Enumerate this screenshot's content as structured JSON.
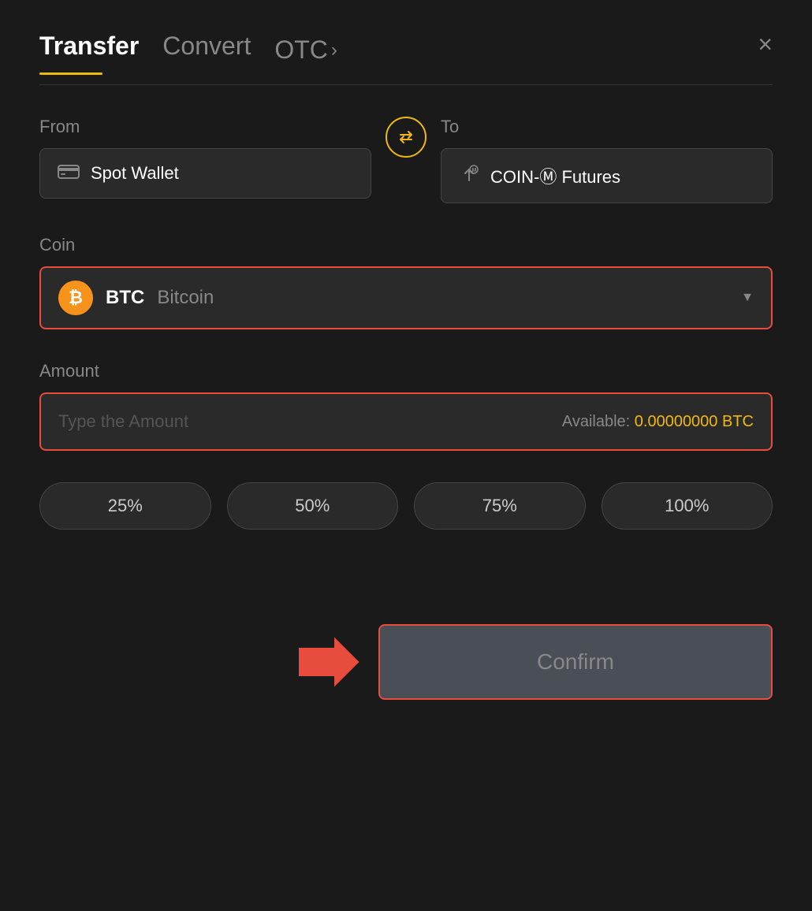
{
  "header": {
    "tab_transfer": "Transfer",
    "tab_convert": "Convert",
    "tab_otc": "OTC",
    "tab_otc_chevron": "›",
    "close_label": "×"
  },
  "from": {
    "label": "From",
    "wallet_icon": "▬",
    "wallet_name": "Spot Wallet"
  },
  "swap": {
    "icon": "⇄"
  },
  "to": {
    "label": "To",
    "icon": "↑",
    "wallet_name": "COIN-M Futures",
    "m_symbol": "Ⓜ"
  },
  "coin": {
    "label": "Coin",
    "symbol": "BTC",
    "full_name": "Bitcoin",
    "btc_symbol": "₿"
  },
  "amount": {
    "label": "Amount",
    "placeholder": "Type the Amount",
    "available_label": "Available:",
    "available_value": "0.00000000 BTC"
  },
  "percentages": [
    {
      "label": "25%"
    },
    {
      "label": "50%"
    },
    {
      "label": "75%"
    },
    {
      "label": "100%"
    }
  ],
  "confirm": {
    "label": "Confirm"
  },
  "colors": {
    "accent": "#f0b90b",
    "red": "#e74c3c",
    "bg": "#1a1a1a",
    "card_bg": "#2a2a2a"
  }
}
